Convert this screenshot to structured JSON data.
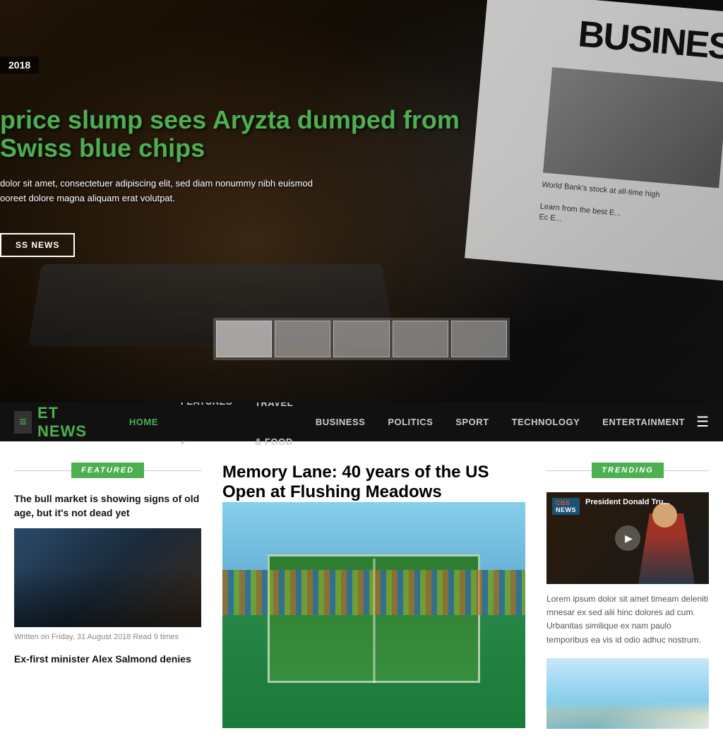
{
  "site": {
    "name": "ET NEWS",
    "logo_icon": "≡"
  },
  "nav": {
    "links": [
      {
        "label": "HOME",
        "active": true,
        "has_arrow": false
      },
      {
        "label": "FEATURES",
        "active": false,
        "has_arrow": true
      },
      {
        "label": "TRAVEL & FOOD",
        "active": false,
        "has_arrow": false
      },
      {
        "label": "BUSINESS",
        "active": false,
        "has_arrow": false
      },
      {
        "label": "POLITICS",
        "active": false,
        "has_arrow": false
      },
      {
        "label": "SPORT",
        "active": false,
        "has_arrow": false
      },
      {
        "label": "TECHNOLOGY",
        "active": false,
        "has_arrow": false
      },
      {
        "label": "ENTERTAINMENT",
        "active": false,
        "has_arrow": false
      }
    ]
  },
  "hero": {
    "date": "2018",
    "headline": "price slump sees Aryzta dumped from Swiss blue chips",
    "description_line1": "dolor sit amet, consectetuer adipiscing elit, sed diam nonummy nibh euismod",
    "description_line2": "ooreet dolore magna aliquam erat volutpat.",
    "cta_label": "SS NEWS",
    "newspaper_title": "BUSINES",
    "newspaper_sub": "World Bank's stock at all-time high",
    "newspaper_line1": "Learn from the best E...",
    "newspaper_line2": "Ec E..."
  },
  "featured": {
    "badge": "FEATURED",
    "article1": {
      "title": "The bull market is showing signs of old age, but it's not dead yet",
      "meta": "Written on Friday, 31 August 2018 Read 9 times"
    },
    "article2": {
      "title": "Ex-first minister Alex Salmond denies"
    }
  },
  "main_article": {
    "title": "Memory Lane: 40 years of the US Open at Flushing Meadows"
  },
  "trending": {
    "badge": "TRENDING",
    "video": {
      "network": "CBS",
      "network2": "NEWS",
      "title": "President Donald Tru...",
      "play_label": "▶"
    },
    "description": "Lorem ipsum dolor sit amet timeam deleniti mnesar ex sed alii hinc dolores ad cum. Urbanitas similique ex nam paulo temporibus ea vis id odio adhuc nostrum."
  }
}
